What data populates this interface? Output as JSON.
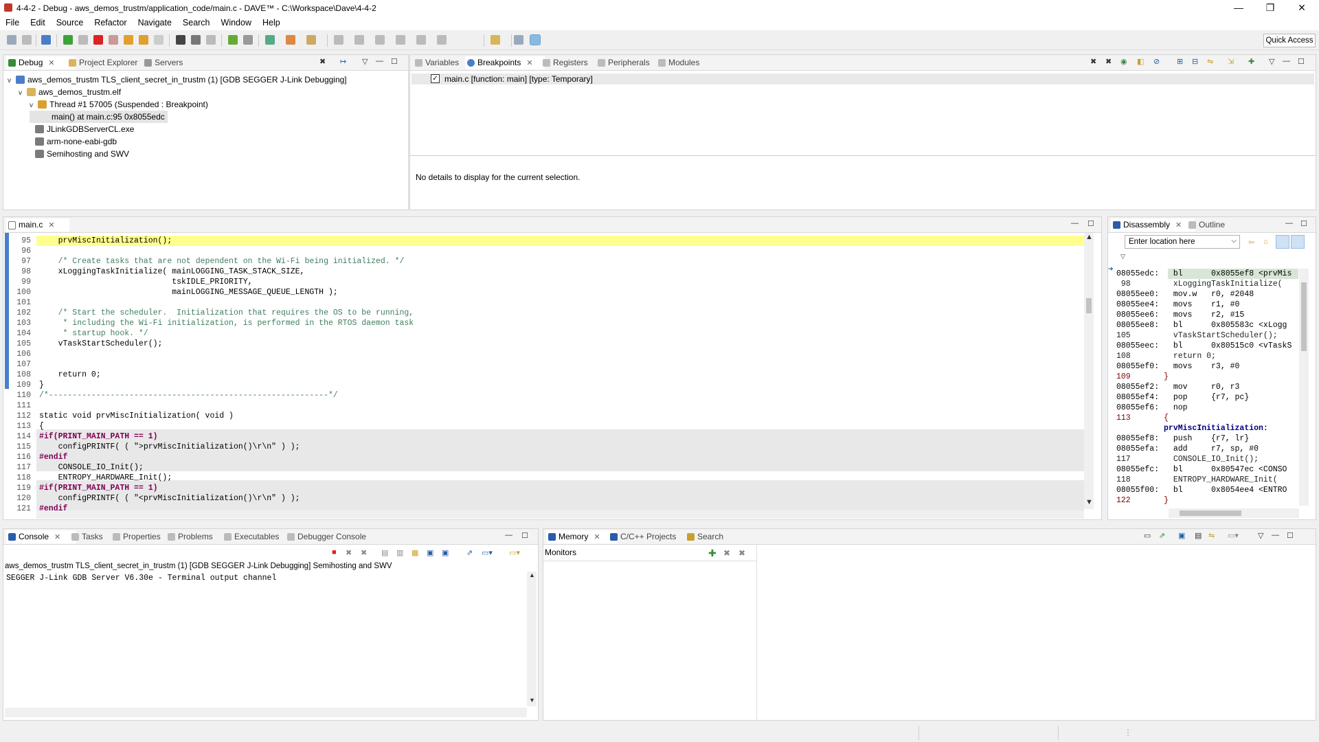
{
  "window": {
    "title": "4-4-2 - Debug - aws_demos_trustm/application_code/main.c - DAVE™ - C:\\Workspace\\Dave\\4-4-2",
    "controls": [
      "—",
      "❐",
      "✕"
    ]
  },
  "menu": [
    "File",
    "Edit",
    "Source",
    "Refactor",
    "Navigate",
    "Search",
    "Window",
    "Help"
  ],
  "quick_access": "Quick Access",
  "debug_panel": {
    "tabs": [
      "Debug",
      "Project Explorer",
      "Servers"
    ],
    "tree": [
      {
        "text": "aws_demos_trustm TLS_client_secret_in_trustm (1) [GDB SEGGER J-Link Debugging]",
        "twisty": "v"
      },
      {
        "text": "aws_demos_trustm.elf",
        "twisty": "v"
      },
      {
        "text": "Thread #1 57005 (Suspended : Breakpoint)",
        "twisty": "v"
      },
      {
        "text": "main() at main.c:95 0x8055edc",
        "twisty": ""
      },
      {
        "text": "JLinkGDBServerCL.exe",
        "twisty": ""
      },
      {
        "text": "arm-none-eabi-gdb",
        "twisty": ""
      },
      {
        "text": "Semihosting and SWV",
        "twisty": ""
      }
    ]
  },
  "breakpoints_panel": {
    "tabs": [
      "Variables",
      "Breakpoints",
      "Registers",
      "Peripherals",
      "Modules"
    ],
    "item": "main.c [function: main] [type: Temporary]",
    "details": "No details to display for the current selection."
  },
  "editor": {
    "tab": "main.c",
    "lines": [
      {
        "n": "95",
        "t": "    prvMiscInitialization();"
      },
      {
        "n": "96",
        "t": ""
      },
      {
        "n": "97",
        "t": "    /* Create tasks that are not dependent on the Wi-Fi being initialized. */"
      },
      {
        "n": "98",
        "t": "    xLoggingTaskInitialize( mainLOGGING_TASK_STACK_SIZE,"
      },
      {
        "n": "99",
        "t": "                            tskIDLE_PRIORITY,"
      },
      {
        "n": "100",
        "t": "                            mainLOGGING_MESSAGE_QUEUE_LENGTH );"
      },
      {
        "n": "101",
        "t": ""
      },
      {
        "n": "102",
        "t": "    /* Start the scheduler.  Initialization that requires the OS to be running,"
      },
      {
        "n": "103",
        "t": "     * including the Wi-Fi initialization, is performed in the RTOS daemon task"
      },
      {
        "n": "104",
        "t": "     * startup hook. */"
      },
      {
        "n": "105",
        "t": "    vTaskStartScheduler();"
      },
      {
        "n": "106",
        "t": ""
      },
      {
        "n": "107",
        "t": ""
      },
      {
        "n": "108",
        "t": "    return 0;"
      },
      {
        "n": "109",
        "t": "}"
      },
      {
        "n": "110",
        "t": "/*-----------------------------------------------------------*/"
      },
      {
        "n": "111",
        "t": ""
      },
      {
        "n": "112",
        "t": "static void prvMiscInitialization( void )"
      },
      {
        "n": "113",
        "t": "{"
      },
      {
        "n": "114",
        "t": "#if(PRINT_MAIN_PATH == 1)"
      },
      {
        "n": "115",
        "t": "    configPRINTF( ( \">prvMiscInitialization()\\r\\n\" ) );"
      },
      {
        "n": "116",
        "t": "#endif"
      },
      {
        "n": "117",
        "t": "    CONSOLE_IO_Init();"
      },
      {
        "n": "118",
        "t": "    ENTROPY_HARDWARE_Init();"
      },
      {
        "n": "119",
        "t": "#if(PRINT_MAIN_PATH == 1)"
      },
      {
        "n": "120",
        "t": "    configPRINTF( ( \"<prvMiscInitialization()\\r\\n\" ) );"
      },
      {
        "n": "121",
        "t": "#endif"
      }
    ]
  },
  "disassembly": {
    "tabs": [
      "Disassembly",
      "Outline"
    ],
    "location_placeholder": "Enter location here",
    "lines": [
      "08055edc:   bl      0x8055ef8 <prvMis",
      " 98         xLoggingTaskInitialize(",
      "08055ee0:   mov.w   r0, #2048",
      "08055ee4:   movs    r1, #0",
      "08055ee6:   movs    r2, #15",
      "08055ee8:   bl      0x805583c <xLogg",
      "105         vTaskStartScheduler();",
      "08055eec:   bl      0x80515c0 <vTaskS",
      "108         return 0;",
      "08055ef0:   movs    r3, #0",
      "109       }",
      "08055ef2:   mov     r0, r3",
      "08055ef4:   pop     {r7, pc}",
      "08055ef6:   nop",
      "113       {",
      "          prvMiscInitialization:",
      "08055ef8:   push    {r7, lr}",
      "08055efa:   add     r7, sp, #0",
      "117         CONSOLE_IO_Init();",
      "08055efc:   bl      0x80547ec <CONSO",
      "118         ENTROPY_HARDWARE_Init(",
      "08055f00:   bl      0x8054ee4 <ENTRO",
      "122       }"
    ]
  },
  "console": {
    "tabs": [
      "Console",
      "Tasks",
      "Properties",
      "Problems",
      "Executables",
      "Debugger Console"
    ],
    "header": "aws_demos_trustm TLS_client_secret_in_trustm (1) [GDB SEGGER J-Link Debugging] Semihosting and SWV",
    "output": "SEGGER J-Link GDB Server V6.30e - Terminal output channel"
  },
  "memory": {
    "tabs": [
      "Memory",
      "C/C++ Projects",
      "Search"
    ],
    "monitors_label": "Monitors"
  }
}
